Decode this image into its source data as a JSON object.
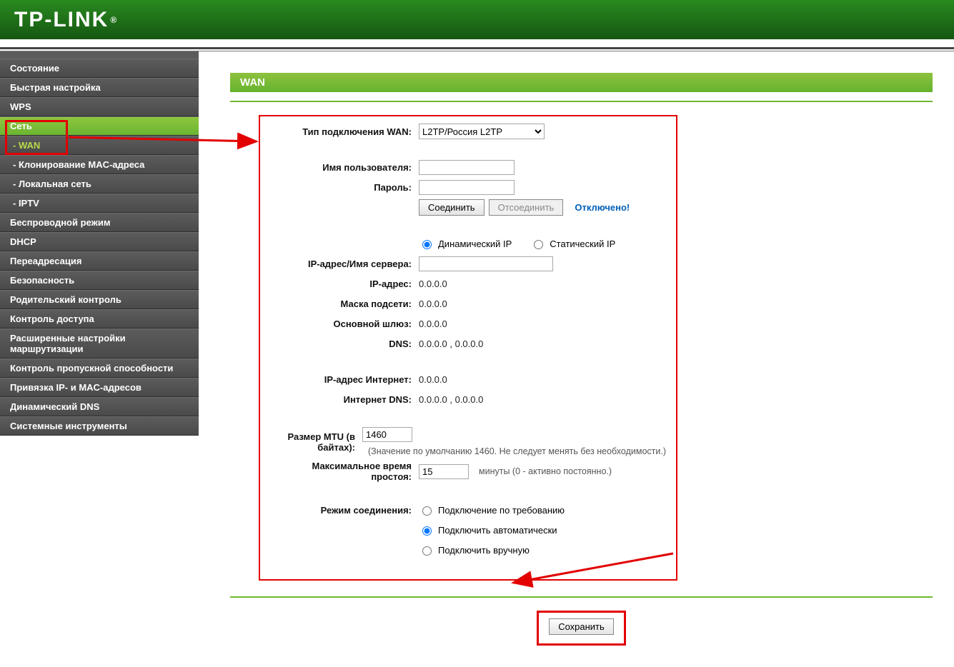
{
  "brand": "TP-LINK",
  "page_title": "WAN",
  "sidebar": {
    "items": [
      {
        "label": "Состояние"
      },
      {
        "label": "Быстрая настройка"
      },
      {
        "label": "WPS"
      },
      {
        "label": "Сеть"
      },
      {
        "label": "- WAN"
      },
      {
        "label": "- Клонирование MAC-адреса"
      },
      {
        "label": "- Локальная сеть"
      },
      {
        "label": "- IPTV"
      },
      {
        "label": "Беспроводной режим"
      },
      {
        "label": "DHCP"
      },
      {
        "label": "Переадресация"
      },
      {
        "label": "Безопасность"
      },
      {
        "label": "Родительский контроль"
      },
      {
        "label": "Контроль доступа"
      },
      {
        "label": "Расширенные настройки маршрутизации"
      },
      {
        "label": "Контроль пропускной способности"
      },
      {
        "label": "Привязка IP- и MAC-адресов"
      },
      {
        "label": "Динамический DNS"
      },
      {
        "label": "Системные инструменты"
      }
    ]
  },
  "wan": {
    "conn_type_label": "Тип подключения WAN:",
    "conn_type_value": "L2TP/Россия L2TP",
    "username_label": "Имя пользователя:",
    "password_label": "Пароль:",
    "connect_btn": "Соединить",
    "disconnect_btn": "Отсоединить",
    "status": "Отключено!",
    "ip_mode_dynamic": "Динамический IP",
    "ip_mode_static": "Статический IP",
    "server_label": "IP-адрес/Имя сервера:",
    "ip_label": "IP-адрес:",
    "ip_value": "0.0.0.0",
    "mask_label": "Маска подсети:",
    "mask_value": "0.0.0.0",
    "gateway_label": "Основной шлюз:",
    "gateway_value": "0.0.0.0",
    "dns_label": "DNS:",
    "dns_value": "0.0.0.0 , 0.0.0.0",
    "internet_ip_label": "IP-адрес Интернет:",
    "internet_ip_value": "0.0.0.0",
    "internet_dns_label": "Интернет DNS:",
    "internet_dns_value": "0.0.0.0 , 0.0.0.0",
    "mtu_label": "Размер MTU (в байтах):",
    "mtu_value": "1460",
    "mtu_hint": "(Значение по умолчанию 1460. Не следует менять без необходимости.)",
    "idle_label": "Максимальное время простоя:",
    "idle_value": "15",
    "idle_hint": "минуты (0 - активно постоянно.)",
    "mode_label": "Режим соединения:",
    "mode_demand": "Подключение по требованию",
    "mode_auto": "Подключить автоматически",
    "mode_manual": "Подключить вручную"
  },
  "save_btn": "Сохранить"
}
